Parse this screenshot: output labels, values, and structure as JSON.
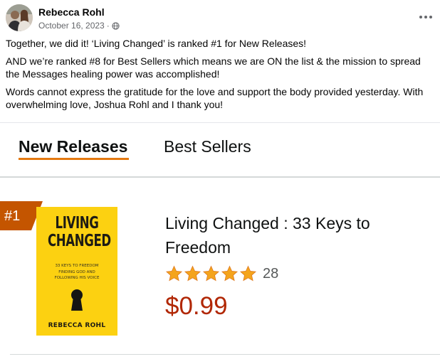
{
  "post": {
    "author": "Rebecca Rohl",
    "date": "October 16, 2023",
    "separator": "·",
    "privacy_icon": "globe-icon",
    "more_icon": "more-options-icon",
    "paragraphs": [
      "Together, we did it! ‘Living Changed’ is ranked #1 for New Releases!",
      "AND we’re ranked #8 for Best Sellers which means we are ON the list & the mission to spread the Messages healing power was accomplished!",
      "Words cannot express the gratitude for the love and support the body provided yesterday. With overwhelming love, Joshua Rohl and I thank you!"
    ]
  },
  "listing": {
    "tabs": [
      {
        "label": "New Releases",
        "active": true
      },
      {
        "label": "Best Sellers",
        "active": false
      }
    ],
    "rank": "#1",
    "cover": {
      "title_line1": "LIVING",
      "title_line2": "CHANGED",
      "subtitle_line1": "33 KEYS TO FREEDOM",
      "subtitle_line2": "FINDING GOD AND",
      "subtitle_line3": "FOLLOWING HIS VOICE",
      "author": "REBECCA ROHL"
    },
    "book_title": "Living Changed : 33 Keys to Freedom",
    "rating_stars": 5,
    "rating_count": "28",
    "price": "$0.99"
  },
  "colors": {
    "accent_underline": "#e47911",
    "rank_badge": "#c45500",
    "price": "#b12704",
    "star": "#f4a41c",
    "cover_bg": "#fcd111"
  }
}
